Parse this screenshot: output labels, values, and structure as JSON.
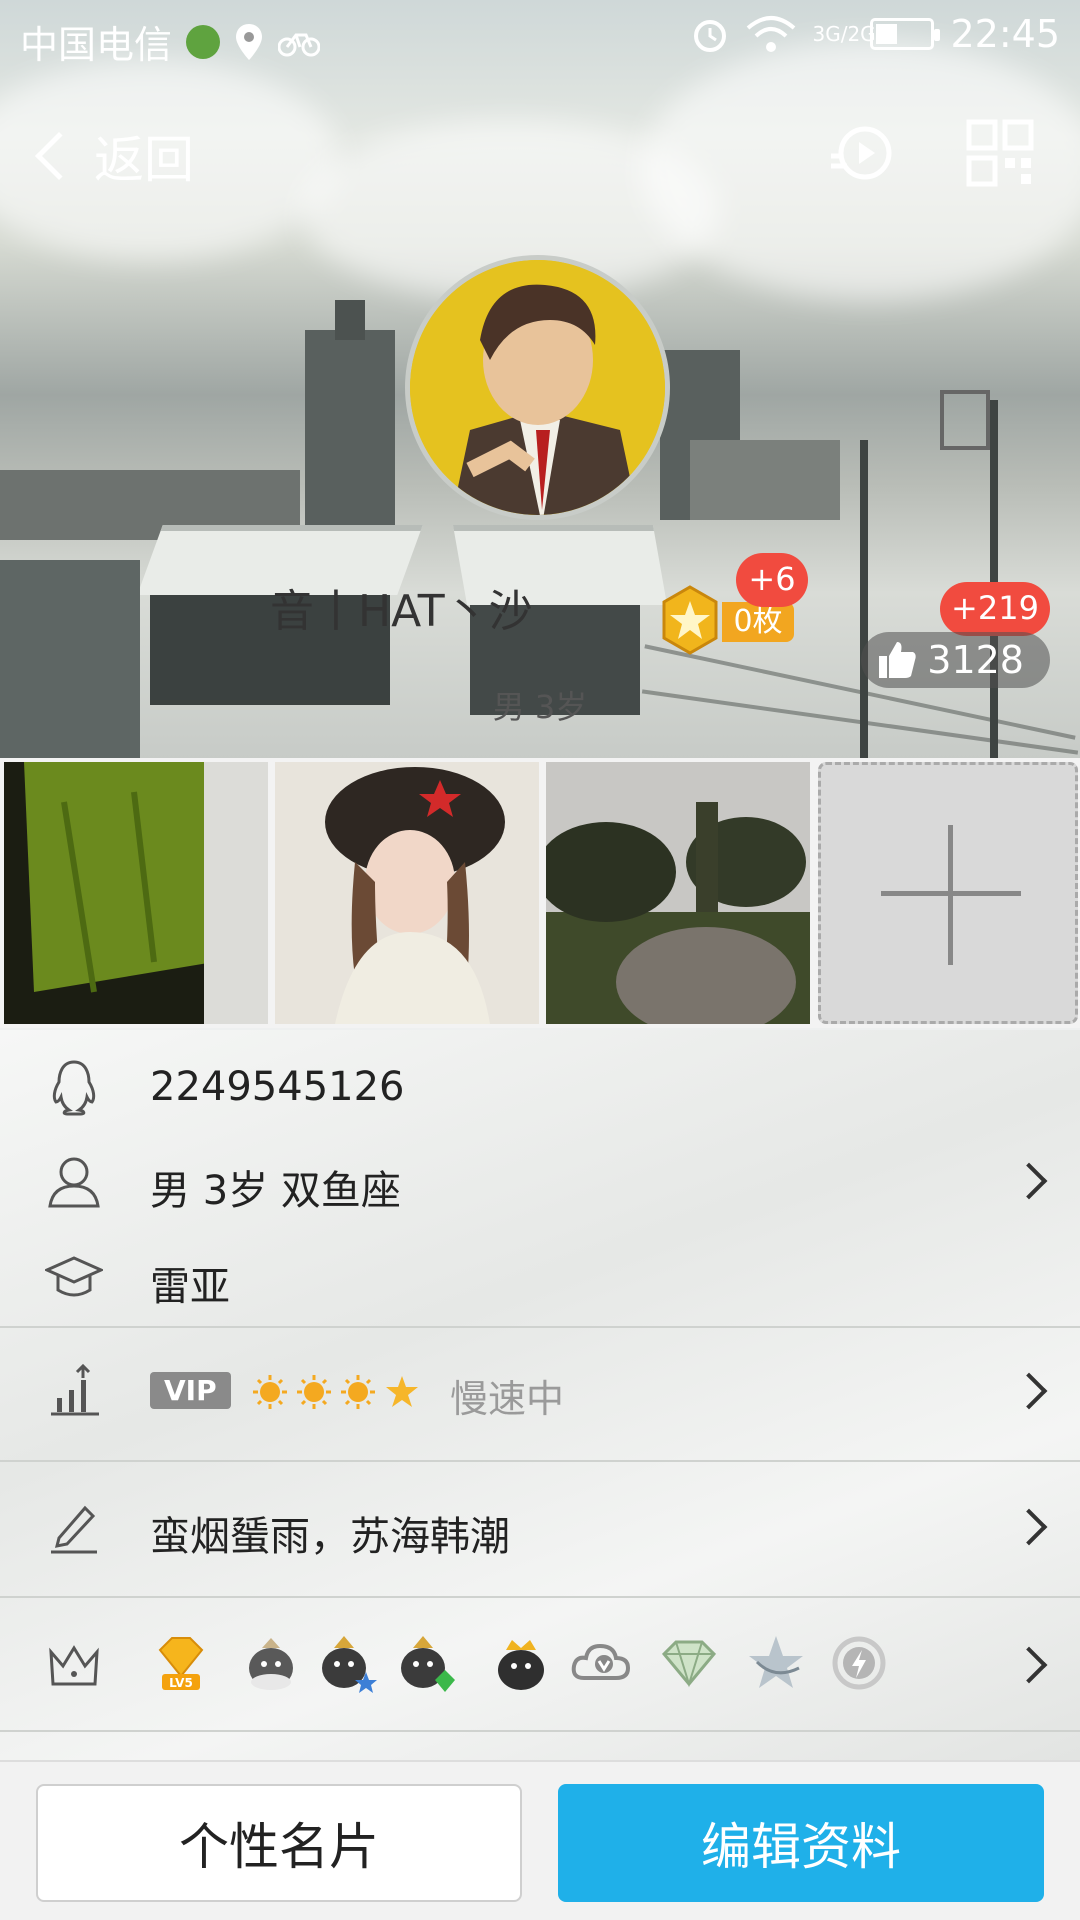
{
  "status_bar": {
    "carrier": "中国电信",
    "network": "3G/2G",
    "time": "22:45",
    "battery_level": 0.4
  },
  "nav": {
    "back_label": "返回"
  },
  "profile": {
    "nickname": "音丨HAT丶沙",
    "medal_count": "0枚",
    "medal_new": "+6",
    "likes": "3128",
    "likes_new": "+219",
    "sub_info": "男 3岁"
  },
  "info": {
    "qq_number": "2249545126",
    "basic": "男  3岁  双鱼座",
    "school": "雷亚",
    "vip_label": "VIP",
    "vip_status": "慢速中",
    "signature": "蛮烟蜑雨，苏海韩潮",
    "badge_icons": [
      "diamond-lv5-icon",
      "qq-penguin-icon",
      "qq-penguin-star-icon",
      "qq-penguin-green-icon",
      "qq-penguin-crown-icon",
      "qq-cloud-v-icon",
      "green-diamond-icon",
      "star-icon",
      "lightning-icon"
    ],
    "badge_lv_text": "LV5"
  },
  "buttons": {
    "card": "个性名片",
    "edit": "编辑资料"
  },
  "colors": {
    "primary": "#1fb0e9",
    "badge_red": "#f14b3f",
    "medal_gold": "#f2a620"
  }
}
